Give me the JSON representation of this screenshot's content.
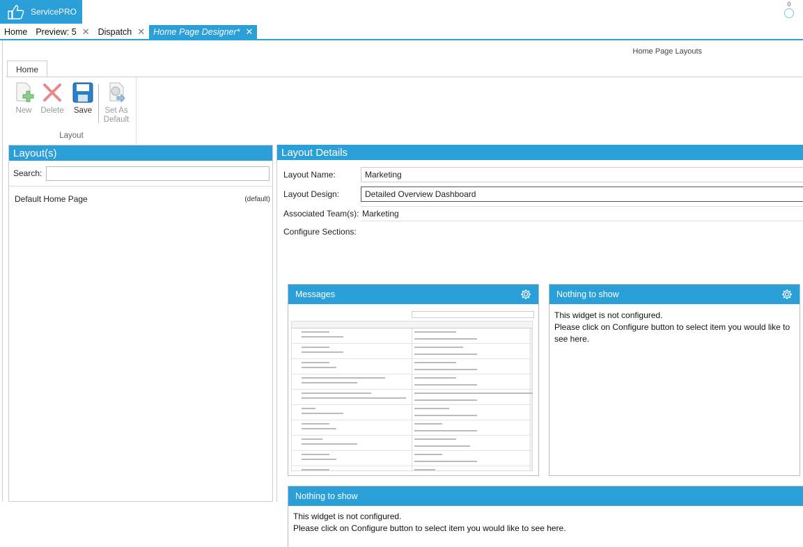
{
  "app": {
    "name": "ServicePRO",
    "notification_count": "0"
  },
  "tabs": [
    {
      "label": "Home",
      "closable": false,
      "active": false
    },
    {
      "label": "Preview: 5",
      "closable": true,
      "active": false
    },
    {
      "label": "Dispatch",
      "closable": true,
      "active": false
    },
    {
      "label": "Home Page Designer*",
      "closable": true,
      "active": true
    }
  ],
  "close_glyph": "✕",
  "header": {
    "title": "Home Page Layouts"
  },
  "ribbon": {
    "tab": "Home",
    "buttons": {
      "new": "New",
      "delete": "Delete",
      "save": "Save",
      "set_default_1": "Set As",
      "set_default_2": "Default"
    },
    "group_label": "Layout"
  },
  "layouts_panel": {
    "title": "Layout(s)",
    "search_label": "Search:",
    "search_value": "",
    "items": [
      {
        "name": "Default Home Page",
        "tag": "(default)"
      }
    ]
  },
  "details": {
    "title": "Layout Details",
    "name_label": "Layout Name:",
    "name_value": "Marketing",
    "design_label": "Layout Design:",
    "design_value": "Detailed Overview Dashboard",
    "team_label": "Associated Team(s):",
    "team_value": "Marketing",
    "sections_label": "Configure Sections:"
  },
  "widgets": {
    "messages": {
      "title": "Messages"
    },
    "widget2": {
      "title": "Nothing to show",
      "line1": "This widget is not configured.",
      "line2": "Please click on Configure button to select item you would like to see here."
    },
    "widget3": {
      "title": "Nothing to show",
      "line1": "This widget is not configured.",
      "line2": "Please click on Configure button to select item you would like to see here."
    }
  },
  "colors": {
    "accent": "#2b9fd8"
  }
}
